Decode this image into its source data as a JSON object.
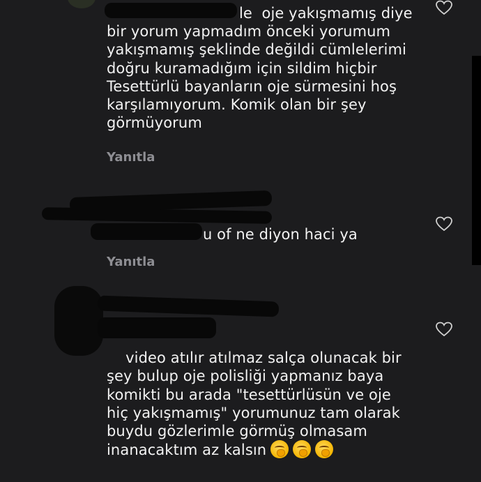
{
  "comments": [
    {
      "text": "le  oje yakışmamış diye bir yorum yapmadım önceki yorumum yakışmamış şeklinde değildi cümlelerimi doğru kuramadığım için sildim hiçbir Tesettürlü bayanların oje sürmesini hoş karşılamıyorum. Komik olan bir şey görmüyorum",
      "reply_label": "Yanıtla"
    },
    {
      "text": "u of ne diyon haci ya",
      "reply_label": "Yanıtla"
    },
    {
      "text": "video atılır atılmaz salça olunacak bir şey bulup oje polisliği yapmanız baya komikti bu arada \"tesettürlüsün ve oje hiç yakışmamış\" yorumunuz tam olarak buydu gözlerimle görmüş olmasam inanacaktım az kalsın",
      "emojis": [
        "yawning-face",
        "yawning-face",
        "yawning-face"
      ]
    }
  ],
  "icons": {
    "like": "heart-outline-icon"
  },
  "colors": {
    "background": "#1c1c1e",
    "text": "#f2f2f2",
    "muted": "#8e8e93"
  }
}
